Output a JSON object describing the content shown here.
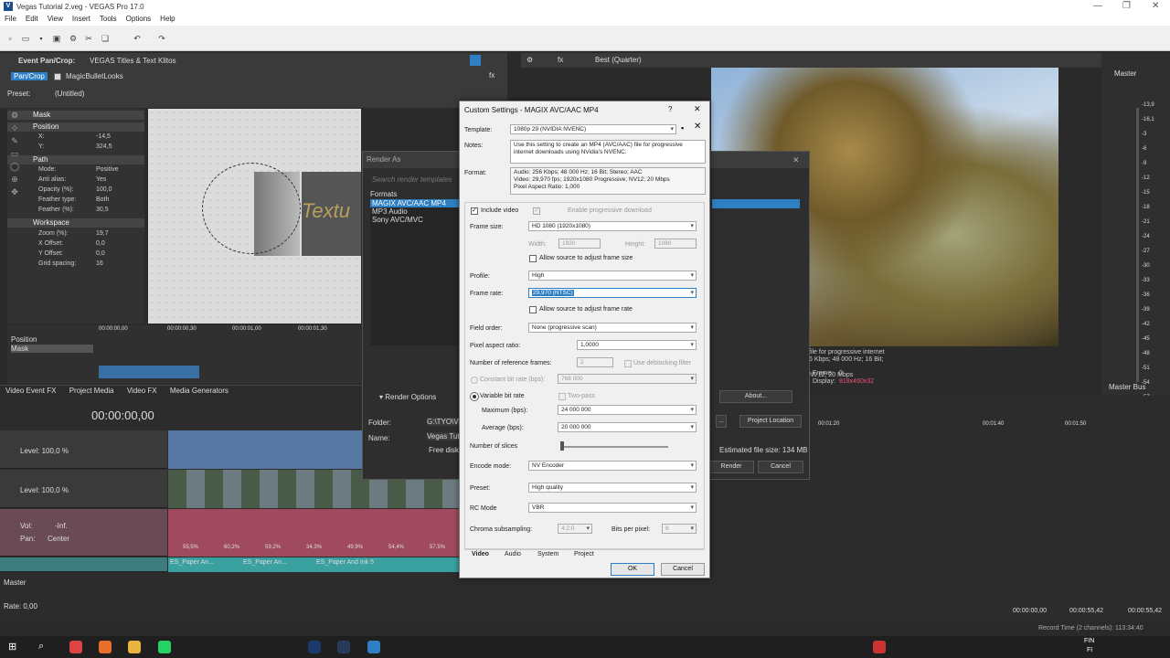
{
  "window": {
    "title": "Vegas Tutorial 2.veg - VEGAS Pro 17.0",
    "logo": "V"
  },
  "menu": [
    "File",
    "Edit",
    "View",
    "Insert",
    "Tools",
    "Options",
    "Help"
  ],
  "pancrop": {
    "header": "Event Pan/Crop:",
    "clip": "VEGAS Titles & Text Klitos",
    "tab_pancrop": "Pan/Crop",
    "tab_magic": "MagicBulletLooks",
    "preset_label": "Preset:",
    "preset_value": "(Untitled)",
    "mask_section": "Mask",
    "position_section": "Position",
    "x_label": "X:",
    "x_value": "-14,5",
    "y_label": "Y:",
    "y_value": "324,5",
    "path_section": "Path",
    "mode_label": "Mode:",
    "mode_value": "Positive",
    "antialias_label": "Anti alias:",
    "antialias_value": "Yes",
    "opacity_label": "Opacity (%):",
    "opacity_value": "100,0",
    "feathertype_label": "Feather type:",
    "feathertype_value": "Both",
    "feather_label": "Feather (%):",
    "feather_value": "30,5",
    "workspace_section": "Workspace",
    "zoom_label": "Zoom (%):",
    "zoom_value": "19,7",
    "xoff_label": "X Offset:",
    "xoff_value": "0,0",
    "yoff_label": "Y Offset:",
    "yoff_value": "0,0",
    "grid_label": "Grid spacing:",
    "grid_value": "16",
    "kf_position": "Position",
    "kf_mask": "Mask",
    "kf_t0": "00:00:00,00",
    "kf_t1": "00:00:00,30",
    "kf_t2": "00:00:01,00",
    "kf_t3": "00:00:01,30",
    "canvas_text": "Textu"
  },
  "docktabs": [
    "Video Event FX",
    "Project Media",
    "Video FX",
    "Media Generators"
  ],
  "preview": {
    "quality": "Best (Quarter)",
    "master": "Master",
    "frame_label": "Frame:",
    "frame_value": "0",
    "display_label": "Display:",
    "display_value": "818x460x32",
    "info1": "file for progressive internet",
    "info2": "6 Kbps; 48 000 Hz; 16 Bit;",
    "info3": "NV12; 20 Mbps",
    "master_bus": "Master Bus",
    "meter": [
      "-13,9",
      "-16,1",
      "-3",
      "-6",
      "-9",
      "-12",
      "-15",
      "-18",
      "-21",
      "-24",
      "-27",
      "-30",
      "-33",
      "-36",
      "-39",
      "-42",
      "-45",
      "-48",
      "-51",
      "-54",
      "-57",
      "-0,0"
    ]
  },
  "timeline": {
    "timecode": "00:00:00,00",
    "level1": "Level: 100,0 %",
    "level2": "Level: 100,0 %",
    "vol_label": "Vol:",
    "vol_value": "-Inf.",
    "pan_label": "Pan:",
    "pan_value": "Center",
    "master": "Master",
    "rate": "Rate: 0,00",
    "ruler": [
      "00:00:00",
      "00:00:10",
      "00:00:20",
      "00:01:20",
      "00:01:40",
      "00:01:50"
    ],
    "audio_pct": [
      "55,5%",
      "60,2%",
      "59,2%",
      "34,3%",
      "49,9%",
      "54,4%",
      "57,5%"
    ],
    "text_clips": [
      "ES_Paper An...",
      "ES_Paper An...",
      "ES_Paper And Ink 5"
    ],
    "time_start": "00:00:00,00",
    "time_end": "00:00:55,42",
    "time_len": "00:00:55,42",
    "record_time": "Record Time (2 channels): 113:34:40"
  },
  "renderas": {
    "title": "Render As",
    "search": "Search render templates",
    "formats_label": "Formats",
    "formats": [
      "MAGIX AVC/AAC MP4",
      "MP3 Audio",
      "Sony AVC/MVC"
    ],
    "render_options": "Render Options",
    "about": "About...",
    "folder_label": "Folder:",
    "folder_value": "G:\\TYO\\V",
    "name_label": "Name:",
    "name_value": "Vegas Tutori",
    "free_disk": "Free disk",
    "project_location": "Project Location",
    "estimated": "Estimated file size: 134 MB",
    "render_btn": "Render",
    "cancel_btn": "Cancel",
    "dots": "..."
  },
  "dialog": {
    "title": "Custom Settings - MAGIX AVC/AAC MP4",
    "help": "?",
    "close": "✕",
    "template_label": "Template:",
    "template_value": "1080p 29 (NVIDIA NVENC)",
    "notes_label": "Notes:",
    "notes_value": "Use this setting to create an MP4 (AVC/AAC) file for progressive internet downloads using NVidia's NVENC.",
    "format_label": "Format:",
    "format_l1": "Audio: 256 Kbps; 48 000 Hz; 16 Bit; Stereo; AAC",
    "format_l2": "Video: 29,970 fps; 1920x1080 Progressive; NV12; 20 Mbps",
    "format_l3": "Pixel Aspect Ratio: 1,000",
    "include_video": "Include video",
    "progressive_dl": "Enable progressive download",
    "frame_size_label": "Frame size:",
    "frame_size_value": "HD 1080 (1920x1080)",
    "width_label": "Width:",
    "width_value": "1920",
    "height_label": "Height:",
    "height_value": "1080",
    "allow_frame_size": "Allow source to adjust frame size",
    "profile_label": "Profile:",
    "profile_value": "High",
    "frame_rate_label": "Frame rate:",
    "frame_rate_value": "29,970 (NTSC)",
    "allow_frame_rate": "Allow source to adjust frame rate",
    "field_order_label": "Field order:",
    "field_order_value": "None (progressive scan)",
    "par_label": "Pixel aspect ratio:",
    "par_value": "1,0000",
    "ref_frames_label": "Number of reference frames:",
    "ref_frames_value": "2",
    "deblock": "Use deblocking filter",
    "cbr_label": "Constant bit rate (bps):",
    "cbr_value": "768 000",
    "vbr_label": "Variable bit rate",
    "twopass": "Two-pass",
    "max_label": "Maximum (bps):",
    "max_value": "24 000 000",
    "avg_label": "Average (bps):",
    "avg_value": "20 000 000",
    "slices_label": "Number of slices",
    "encode_label": "Encode mode:",
    "encode_value": "NV Encoder",
    "preset_label": "Preset:",
    "preset_value": "High quality",
    "rc_label": "RC Mode",
    "rc_value": "VBR",
    "chroma_label": "Chroma subsampling:",
    "chroma_value": "4:2:0",
    "bits_label": "Bits per pixel:",
    "bits_value": "8",
    "tabs": [
      "Video",
      "Audio",
      "System",
      "Project"
    ],
    "ok": "OK",
    "cancel": "Cancel"
  },
  "taskbar": {
    "lang1": "FIN",
    "lang2": "FI"
  }
}
